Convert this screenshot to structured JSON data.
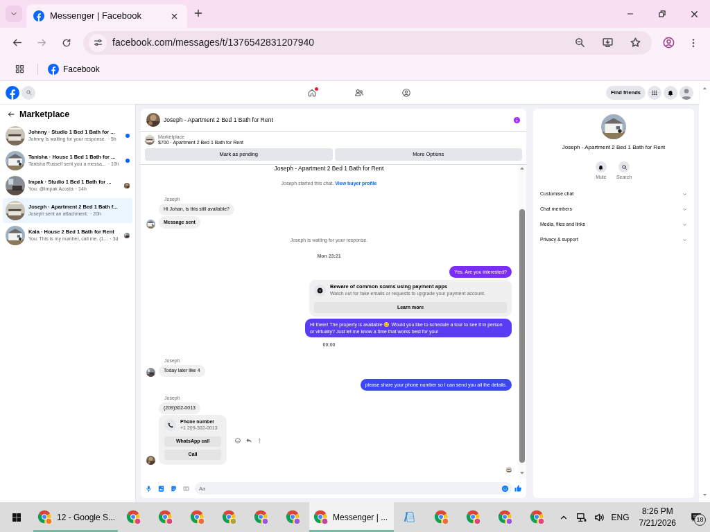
{
  "browser": {
    "tabs": [
      {
        "title": "Messenger | Facebook",
        "selected": true
      }
    ],
    "url": "facebook.com/messages/t/1376542831207940",
    "bookmarks": [
      {
        "label": "Facebook"
      }
    ]
  },
  "top_nav": {
    "items": [
      {
        "kind": "home",
        "notification": true
      },
      {
        "kind": "friends",
        "notification": false
      },
      {
        "kind": "groups",
        "notification": false
      }
    ],
    "find_friends": "Find friends"
  },
  "sidebar": {
    "title": "Marketplace",
    "conversations": [
      {
        "title": "Johnny · Studio 1 Bed 1 Bath for ...",
        "preview": "Johnny is waiting for your response.",
        "time": "· 5h",
        "unread": true,
        "seen": false,
        "selected": false
      },
      {
        "title": "Tanisha · House 1 Bed 1 Bath for ...",
        "preview": "Tanisha Russell sent you a messa...",
        "time": "· 10h",
        "unread": true,
        "seen": false,
        "selected": false
      },
      {
        "title": "Impak · Studio 1 Bed 1 Bath for ...",
        "preview": "You: @Impak Acosta",
        "time": "· 14h",
        "unread": false,
        "seen": true,
        "selected": false
      },
      {
        "title": "Joseph · Apartment 2 Bed 1 Bath f...",
        "preview": "Joseph sent an attachment.",
        "time": "· 20h",
        "unread": false,
        "seen": false,
        "selected": true
      },
      {
        "title": "Kala · House 2 Bed 1 Bath for Rent",
        "preview": "You: This is my number, call me. (1...",
        "time": "· 3d",
        "unread": false,
        "seen": true,
        "selected": false
      }
    ]
  },
  "chat": {
    "title": "Joseph - Apartment 2 Bed 1 Bath for Rent",
    "listing": {
      "label": "Marketplace",
      "text": "$700 · Apartment 2 Bed 1 Bath for Rent"
    },
    "buttons": [
      "Mark as pending",
      "More Options"
    ],
    "messages": [
      {
        "kind": "heading",
        "text": "Joseph - Apartment 2 Bed 1 Bath for Rent"
      },
      {
        "kind": "system",
        "text": "Joseph started this chat.",
        "link": "View buyer profile"
      },
      {
        "kind": "incoming",
        "sender": "Joseph",
        "bubbles": [
          {
            "kind": "text",
            "text": "Hi Johan, is this still available?"
          },
          {
            "kind": "status",
            "text": "Message sent"
          }
        ]
      },
      {
        "kind": "system",
        "text": "Joseph is waiting for your response."
      },
      {
        "kind": "timestamp",
        "text": "Mon 23:21"
      },
      {
        "kind": "outgoing",
        "text": "Yes. Are you interested?",
        "color": "#7b2cf6"
      },
      {
        "kind": "warning",
        "title": "Beware of common scams using payment apps",
        "text": "Watch out for fake emails or requests to upgrade your payment account.",
        "button": "Learn more"
      },
      {
        "kind": "outgoing",
        "text": "Hi there! The property is available 😊 Would you like to schedule a tour to see it in person or virtually? Just let me know a time that works best for you!",
        "color": "#5a3cf5"
      },
      {
        "kind": "timestamp",
        "text": "00:00"
      },
      {
        "kind": "incoming",
        "sender": "Joseph",
        "bubbles": [
          {
            "kind": "text",
            "text": "Today later like 4"
          }
        ]
      },
      {
        "kind": "outgoing",
        "text": "please share your phone number so I can send you all the details.",
        "color": "#3b46f4"
      },
      {
        "kind": "incoming",
        "sender": "Joseph",
        "bubbles": [
          {
            "kind": "text",
            "text": "(209)302-0013"
          },
          {
            "kind": "contact",
            "title": "Phone number",
            "number": "+1 209-302-0013",
            "buttons": [
              "WhatsApp call",
              "Call"
            ]
          }
        ]
      },
      {
        "kind": "seen"
      }
    ],
    "composer": {
      "placeholder": "Aa"
    }
  },
  "right_panel": {
    "title": "Joseph - Apartment 2 Bed 1 Bath for Rent",
    "actions": [
      {
        "kind": "mute",
        "label": "Mute"
      },
      {
        "kind": "search",
        "label": "Search"
      }
    ],
    "sections": [
      {
        "label": "Customise chat",
        "expanded": false
      },
      {
        "label": "Chat members",
        "expanded": false
      },
      {
        "label": "Media, files and links",
        "expanded": false
      },
      {
        "label": "Privacy & support",
        "expanded": false
      }
    ]
  },
  "taskbar": {
    "apps": [
      {
        "kind": "chrome",
        "label": "12 - Google S...",
        "color": "#f07f20",
        "running": true,
        "selected": false
      },
      {
        "kind": "chrome",
        "color": "#e0457a",
        "running": false,
        "selected": false
      },
      {
        "kind": "chrome",
        "color": "#e0457a",
        "running": false,
        "selected": false
      },
      {
        "kind": "chrome",
        "color": "#f06a40",
        "running": false,
        "selected": false
      },
      {
        "kind": "chrome",
        "color": "#b0a040",
        "running": false,
        "selected": false
      },
      {
        "kind": "chrome",
        "color": "#9a5ad8",
        "running": false,
        "selected": false
      },
      {
        "kind": "chrome",
        "color": "#9a5ad8",
        "running": false,
        "selected": false
      },
      {
        "kind": "chrome",
        "label": "Messenger | ...",
        "color": "#c04a9a",
        "running": true,
        "selected": true
      },
      {
        "kind": "notepad",
        "running": false,
        "selected": false
      },
      {
        "kind": "chrome",
        "color": "#f06a40",
        "running": false,
        "selected": false
      },
      {
        "kind": "chrome",
        "color": "#e0457a",
        "running": false,
        "selected": false
      },
      {
        "kind": "chrome",
        "color": "#9a5ad8",
        "running": false,
        "selected": false
      },
      {
        "kind": "chrome",
        "color": "#e0457a",
        "running": false,
        "selected": false
      }
    ],
    "language": "ENG",
    "time": "8:26 PM",
    "date": "7/21/2026",
    "notifications": "18"
  }
}
